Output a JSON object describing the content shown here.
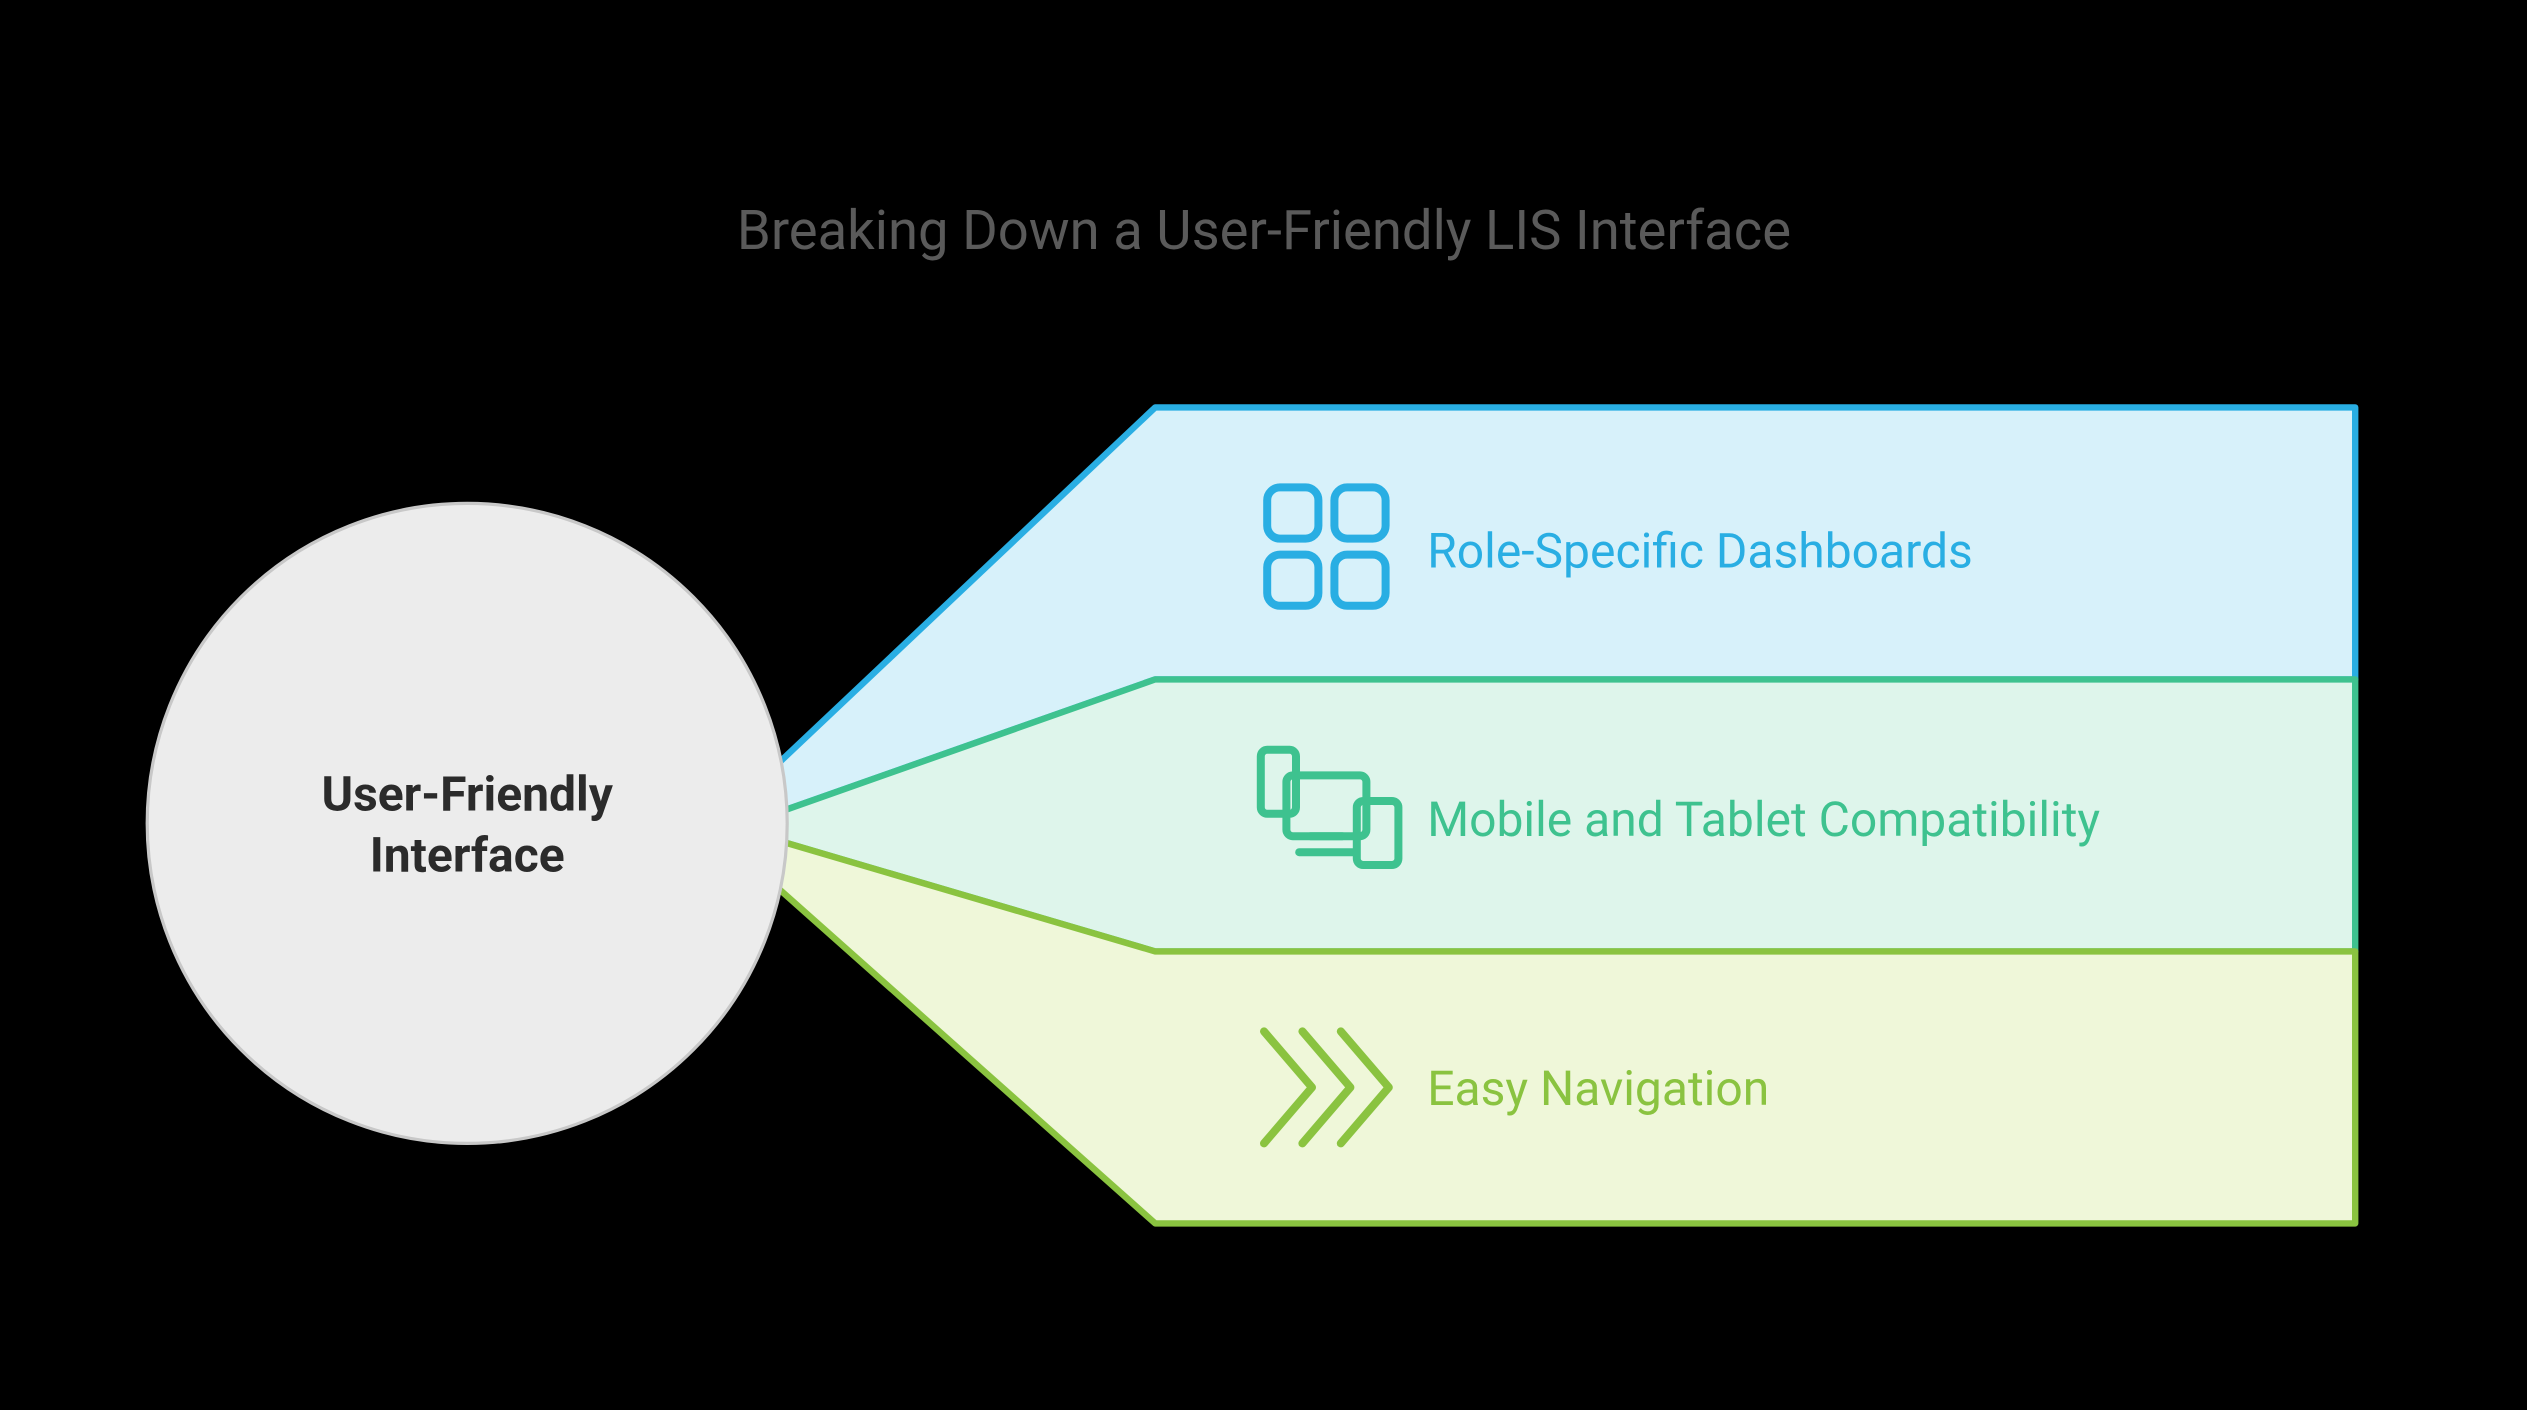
{
  "title": "Breaking Down a User-Friendly LIS Interface",
  "center": {
    "line1": "User-Friendly",
    "line2": "Interface"
  },
  "branches": [
    {
      "label": "Role-Specific Dashboards",
      "icon": "dashboard-icon",
      "stroke": "#29AEE3",
      "fill": "#D7F1FA",
      "textColor": "#29AEE3"
    },
    {
      "label": "Mobile and Tablet Compatibility",
      "icon": "devices-icon",
      "stroke": "#3EC28F",
      "fill": "#DEF5EB",
      "textColor": "#3EC28F"
    },
    {
      "label": "Easy Navigation",
      "icon": "chevrons-icon",
      "stroke": "#8AC340",
      "fill": "#EFF7D9",
      "textColor": "#8AC340"
    }
  ]
}
